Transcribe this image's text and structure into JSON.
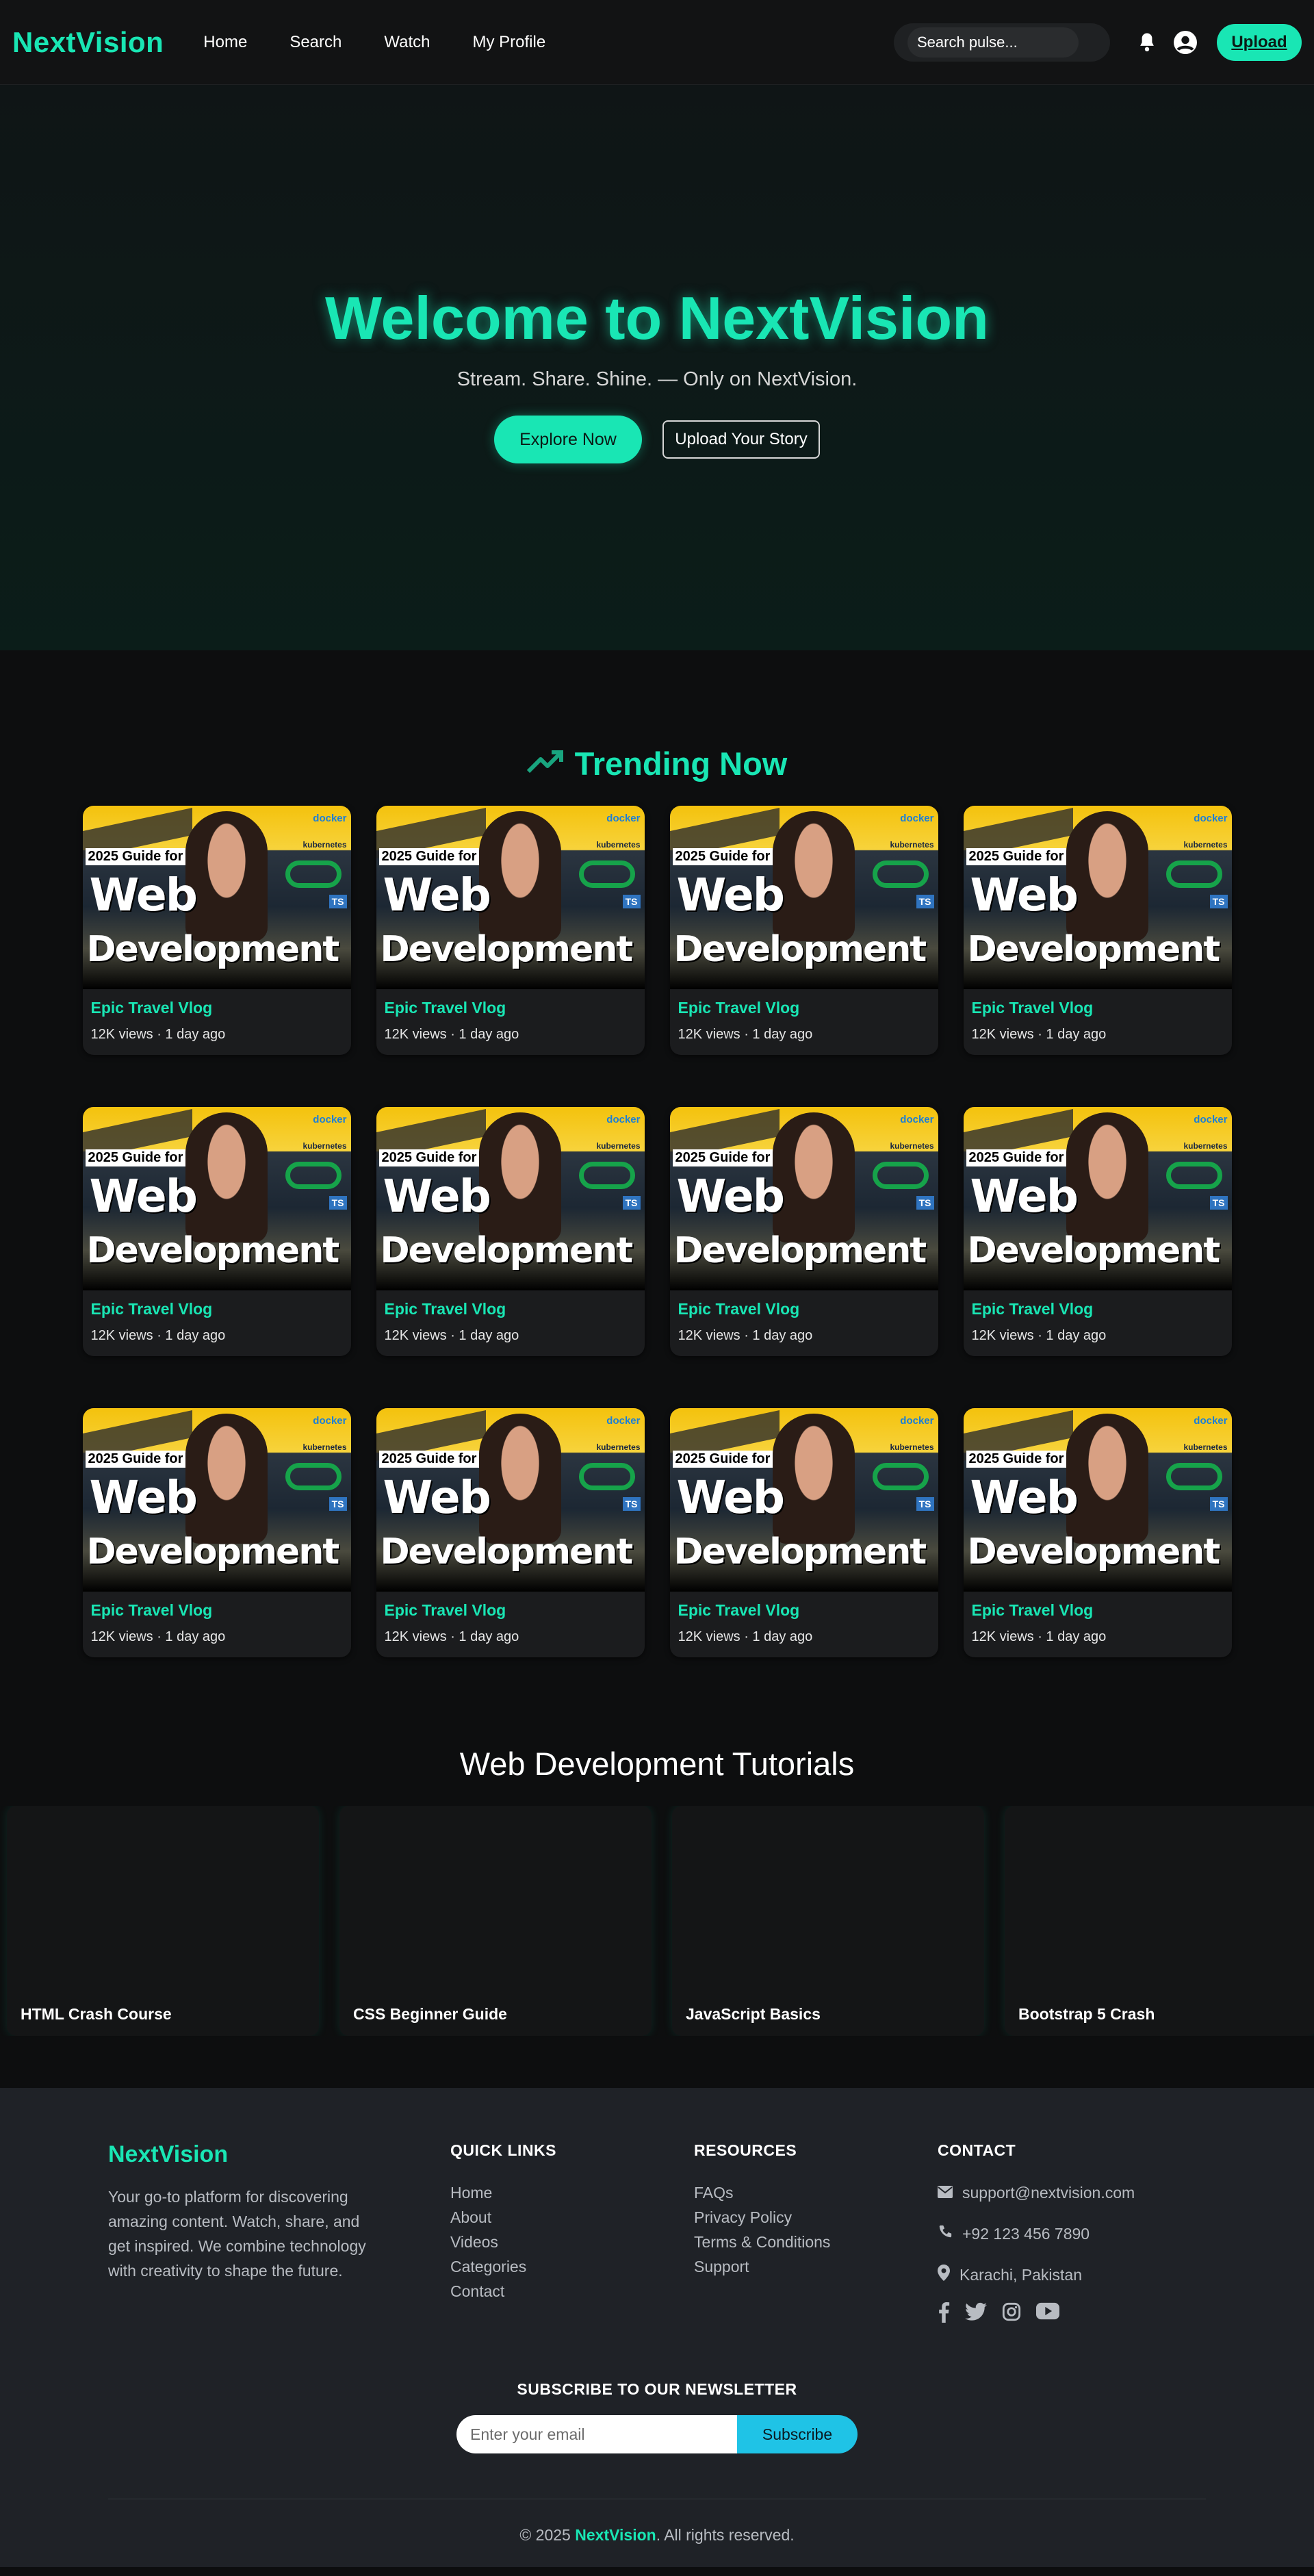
{
  "nav": {
    "brand": "NextVision",
    "links": [
      "Home",
      "Search",
      "Watch",
      "My Profile"
    ],
    "search_placeholder": "Search pulse...",
    "upload_label": "Upload",
    "icons": [
      "bell-icon",
      "user-circle-icon"
    ]
  },
  "hero": {
    "title": "Welcome to NextVision",
    "subtitle": "Stream. Share. Shine. — Only on NextVision.",
    "primary_btn": "Explore Now",
    "secondary_btn": "Upload Your Story"
  },
  "trending": {
    "heading": "Trending Now",
    "heading_icon": "trending-up-icon",
    "thumbnail_text": {
      "tag": "2025 Guide for",
      "line1": "Web",
      "line2": "Development",
      "brand1": "docker",
      "brand2": "kubernetes",
      "brand3": "TS"
    },
    "videos": [
      {
        "title": "Epic Travel Vlog",
        "meta": "12K views · 1 day ago"
      },
      {
        "title": "Epic Travel Vlog",
        "meta": "12K views · 1 day ago"
      },
      {
        "title": "Epic Travel Vlog",
        "meta": "12K views · 1 day ago"
      },
      {
        "title": "Epic Travel Vlog",
        "meta": "12K views · 1 day ago"
      },
      {
        "title": "Epic Travel Vlog",
        "meta": "12K views · 1 day ago"
      },
      {
        "title": "Epic Travel Vlog",
        "meta": "12K views · 1 day ago"
      },
      {
        "title": "Epic Travel Vlog",
        "meta": "12K views · 1 day ago"
      },
      {
        "title": "Epic Travel Vlog",
        "meta": "12K views · 1 day ago"
      },
      {
        "title": "Epic Travel Vlog",
        "meta": "12K views · 1 day ago"
      },
      {
        "title": "Epic Travel Vlog",
        "meta": "12K views · 1 day ago"
      },
      {
        "title": "Epic Travel Vlog",
        "meta": "12K views · 1 day ago"
      },
      {
        "title": "Epic Travel Vlog",
        "meta": "12K views · 1 day ago"
      }
    ]
  },
  "tutorials": {
    "heading": "Web Development Tutorials",
    "items": [
      "HTML Crash Course",
      "CSS Beginner Guide",
      "JavaScript Basics",
      "Bootstrap 5 Crash"
    ]
  },
  "footer": {
    "brand": "NextVision",
    "description": "Your go-to platform for discovering amazing content. Watch, share, and get inspired. We combine technology with creativity to shape the future.",
    "quick_links": {
      "heading": "QUICK LINKS",
      "items": [
        "Home",
        "About",
        "Videos",
        "Categories",
        "Contact"
      ]
    },
    "resources": {
      "heading": "RESOURCES",
      "items": [
        "FAQs",
        "Privacy Policy",
        "Terms & Conditions",
        "Support"
      ]
    },
    "contact": {
      "heading": "CONTACT",
      "email": "support@nextvision.com",
      "phone": "+92 123 456 7890",
      "location": "Karachi, Pakistan",
      "socials": [
        "facebook-icon",
        "twitter-icon",
        "instagram-icon",
        "youtube-icon"
      ]
    },
    "newsletter": {
      "heading": "SUBSCRIBE TO OUR NEWSLETTER",
      "placeholder": "Enter your email",
      "button": "Subscribe"
    },
    "copyright_prefix": "© 2025 ",
    "copyright_brand": "NextVision",
    "copyright_suffix": ". All rights reserved."
  },
  "colors": {
    "accent": "#19e6b4",
    "background": "#0d0e0f",
    "card": "#1b1c1e",
    "footer": "#1f2227",
    "subscribe": "#1fc3e6"
  }
}
